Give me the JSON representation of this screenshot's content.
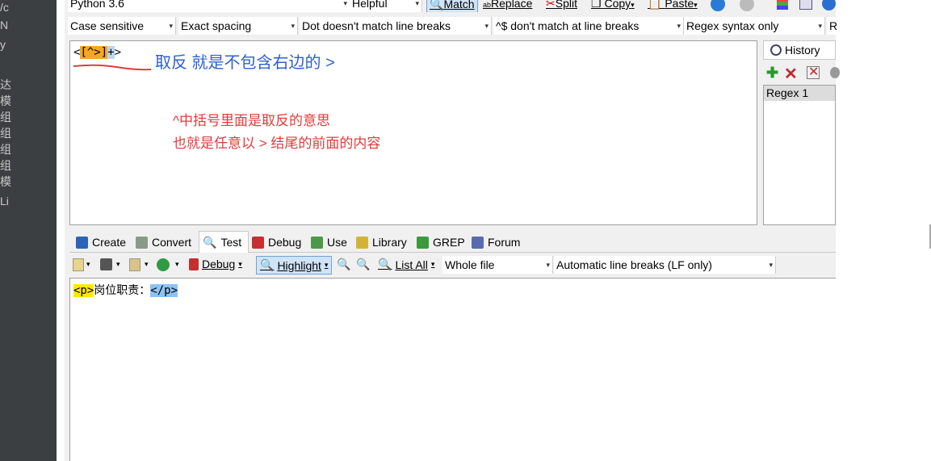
{
  "colors": {
    "strip_bg": "#3c3f41",
    "annotation_blue": "#2e5fd0",
    "annotation_red": "#e23b3b",
    "hl_orange": "#f5a623",
    "hl_yellow": "#ffe800",
    "hl_blue": "#8cc3f5"
  },
  "left_strip": {
    "chars": [
      "/c",
      "N",
      "y",
      "达",
      "模",
      "组",
      "组",
      "组",
      "组",
      "模",
      "Li"
    ]
  },
  "toolbar_top": {
    "flavor": "Python 3.6",
    "helpful": "Helpful",
    "match": "Match",
    "replace": "Replace",
    "split": "Split",
    "copy": "Copy",
    "paste": "Paste"
  },
  "options": {
    "case": "Case sensitive",
    "spacing": "Exact spacing",
    "dot": "Dot doesn't match line breaks",
    "anchors": "^$ don't match at line breaks",
    "syntax": "Regex syntax only",
    "more": "R"
  },
  "regex": {
    "open": "<",
    "class": "[^>]",
    "plus": "+",
    "close": ">"
  },
  "annotations": {
    "blue": "取反 就是不包含右边的 >",
    "red_line1": "^中括号里面是取反的意思",
    "red_line2": "也就是任意以 > 结尾的前面的内容"
  },
  "history": {
    "title": "History",
    "item": "Regex 1"
  },
  "tabs": [
    "Create",
    "Convert",
    "Test",
    "Debug",
    "Use",
    "Library",
    "GREP",
    "Forum"
  ],
  "test_toolbar": {
    "debug": "Debug",
    "highlight": "Highlight",
    "list_all": "List All",
    "scope": "Whole file",
    "line_breaks": "Automatic line breaks (LF only)"
  },
  "test_text": {
    "match1": "<p>",
    "middle": "岗位职责：",
    "match2": "</p>"
  }
}
